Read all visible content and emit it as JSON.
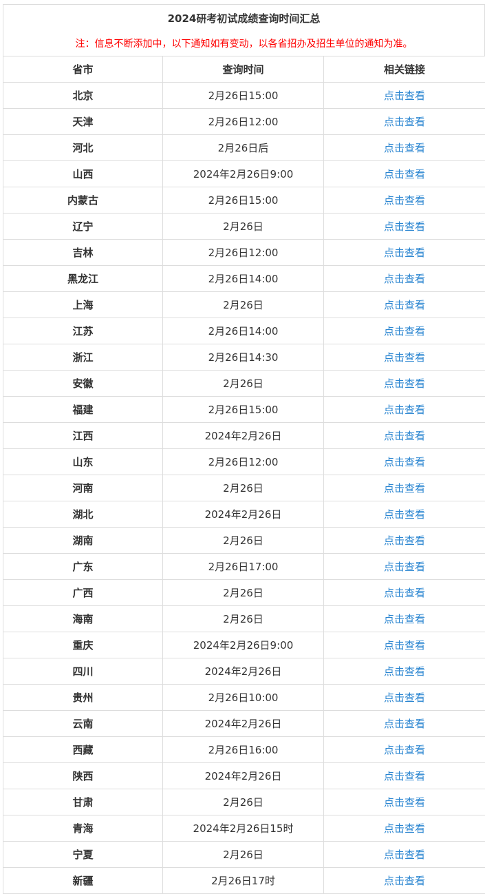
{
  "title": "2024研考初试成绩查询时间汇总",
  "notice": "注：信息不断添加中，以下通知如有变动，以各省招办及招生单位的通知为准。",
  "headers": {
    "province": "省市",
    "time": "查询时间",
    "link": "相关链接"
  },
  "rows": [
    {
      "province": "北京",
      "time": "2月26日15:00",
      "link": "点击查看"
    },
    {
      "province": "天津",
      "time": "2月26日12:00",
      "link": "点击查看"
    },
    {
      "province": "河北",
      "time": "2月26日后",
      "link": "点击查看"
    },
    {
      "province": "山西",
      "time": "2024年2月26日9:00",
      "link": "点击查看"
    },
    {
      "province": "内蒙古",
      "time": "2月26日15:00",
      "link": "点击查看"
    },
    {
      "province": "辽宁",
      "time": "2月26日",
      "link": "点击查看"
    },
    {
      "province": "吉林",
      "time": "2月26日12:00",
      "link": "点击查看"
    },
    {
      "province": "黑龙江",
      "time": "2月26日14:00",
      "link": "点击查看"
    },
    {
      "province": "上海",
      "time": "2月26日",
      "link": "点击查看"
    },
    {
      "province": "江苏",
      "time": "2月26日14:00",
      "link": "点击查看"
    },
    {
      "province": "浙江",
      "time": "2月26日14:30",
      "link": "点击查看"
    },
    {
      "province": "安徽",
      "time": "2月26日",
      "link": "点击查看"
    },
    {
      "province": "福建",
      "time": "2月26日15:00",
      "link": "点击查看"
    },
    {
      "province": "江西",
      "time": "2024年2月26日",
      "link": "点击查看"
    },
    {
      "province": "山东",
      "time": "2月26日12:00",
      "link": "点击查看"
    },
    {
      "province": "河南",
      "time": "2月26日",
      "link": "点击查看"
    },
    {
      "province": "湖北",
      "time": "2024年2月26日",
      "link": "点击查看"
    },
    {
      "province": "湖南",
      "time": "2月26日",
      "link": "点击查看"
    },
    {
      "province": "广东",
      "time": "2月26日17:00",
      "link": "点击查看"
    },
    {
      "province": "广西",
      "time": "2月26日",
      "link": "点击查看"
    },
    {
      "province": "海南",
      "time": "2月26日",
      "link": "点击查看"
    },
    {
      "province": "重庆",
      "time": "2024年2月26日9:00",
      "link": "点击查看"
    },
    {
      "province": "四川",
      "time": "2024年2月26日",
      "link": "点击查看"
    },
    {
      "province": "贵州",
      "time": "2月26日10:00",
      "link": "点击查看"
    },
    {
      "province": "云南",
      "time": "2024年2月26日",
      "link": "点击查看"
    },
    {
      "province": "西藏",
      "time": "2月26日16:00",
      "link": "点击查看"
    },
    {
      "province": "陕西",
      "time": "2024年2月26日",
      "link": "点击查看"
    },
    {
      "province": "甘肃",
      "time": "2月26日",
      "link": "点击查看"
    },
    {
      "province": "青海",
      "time": "2024年2月26日15时",
      "link": "点击查看"
    },
    {
      "province": "宁夏",
      "time": "2月26日",
      "link": "点击查看"
    },
    {
      "province": "新疆",
      "time": "2月26日17时",
      "link": "点击查看"
    }
  ]
}
